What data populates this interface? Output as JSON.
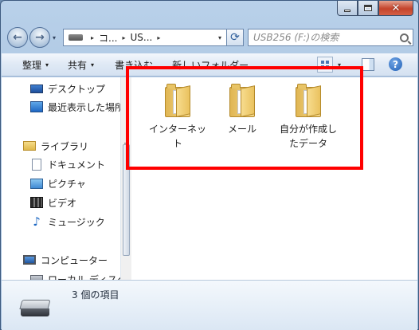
{
  "window": {
    "caption_buttons": {
      "minimize": "minimize-icon",
      "maximize": "maximize-icon",
      "close": "close-icon",
      "close_glyph": "✕"
    }
  },
  "nav": {
    "back_glyph": "←",
    "forward_glyph": "→",
    "dropdown_glyph": "▾"
  },
  "address": {
    "separator": "▸",
    "crumbs": [
      "コ...",
      "US..."
    ],
    "dropdown_glyph": "▾",
    "refresh_glyph": "⟳"
  },
  "search": {
    "placeholder": "USB256 (F:)の検索"
  },
  "commands": {
    "organize": "整理",
    "share": "共有",
    "burn": "書き込む",
    "new_folder": "新しいフォルダー",
    "arrow": "▾",
    "help": "?"
  },
  "sidebar": {
    "items": [
      {
        "label": "デスクトップ",
        "icon": "desktop-icon"
      },
      {
        "label": "最近表示した場所",
        "icon": "recent-places-icon"
      },
      {
        "label": "ライブラリ",
        "icon": "library-icon"
      },
      {
        "label": "ドキュメント",
        "icon": "documents-icon"
      },
      {
        "label": "ピクチャ",
        "icon": "pictures-icon"
      },
      {
        "label": "ビデオ",
        "icon": "videos-icon"
      },
      {
        "label": "ミュージック",
        "icon": "music-icon"
      },
      {
        "label": "コンピューター",
        "icon": "computer-icon"
      },
      {
        "label": "ローカル ディスク",
        "icon": "local-disk-icon"
      }
    ],
    "music_glyph": "♪"
  },
  "content": {
    "folders": [
      {
        "name": "インターネット",
        "icon": "folder-icon"
      },
      {
        "name": "メール",
        "icon": "folder-icon"
      },
      {
        "name": "自分が作成したデータ",
        "icon": "folder-icon"
      }
    ]
  },
  "details": {
    "item_count": "3 個の項目",
    "icon": "usb-drive-icon"
  },
  "annotation": {
    "color": "#ff0000"
  }
}
